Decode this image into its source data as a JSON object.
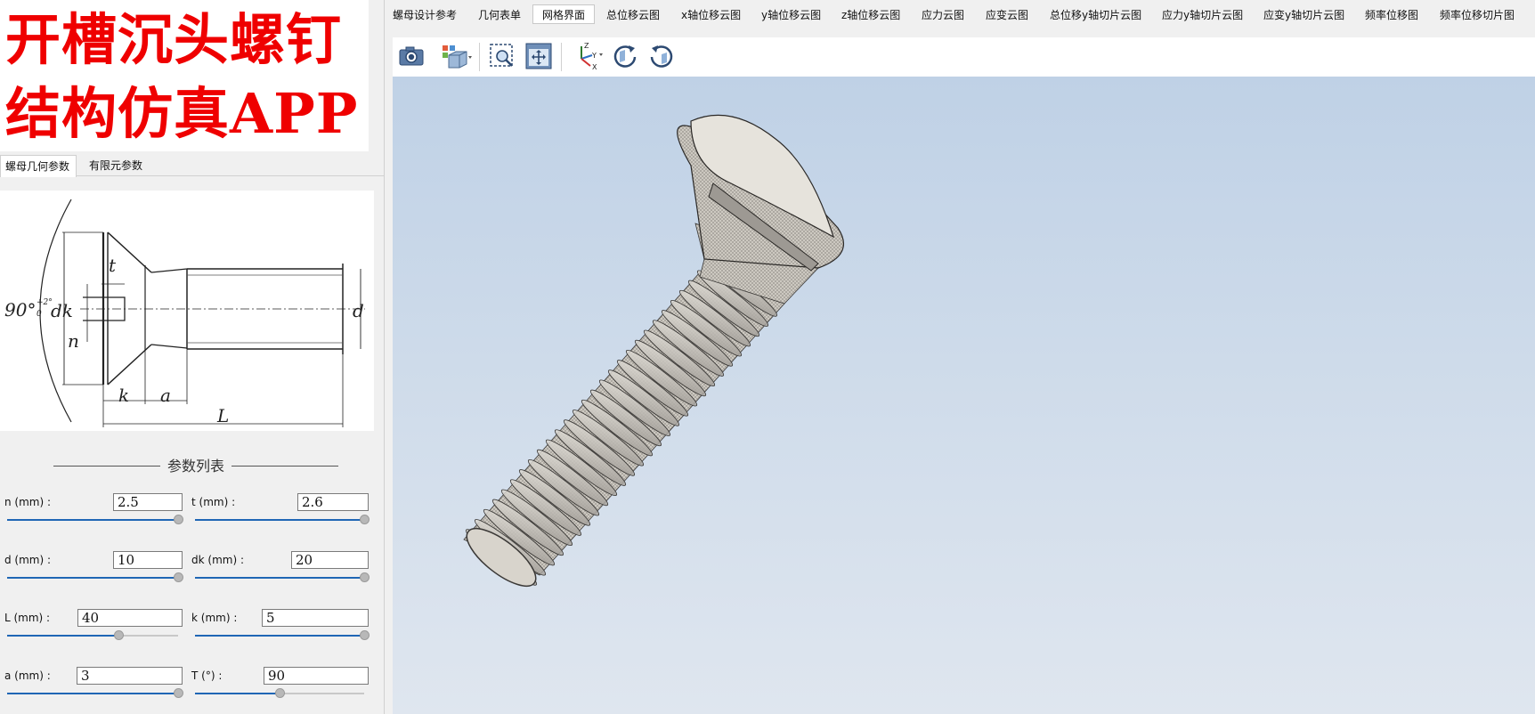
{
  "banner": {
    "line1": "开槽沉头螺钉",
    "line2": "结构仿真APP",
    "color": "#ef0000"
  },
  "left_tabs": [
    {
      "label": "螺母几何参数",
      "active": true
    },
    {
      "label": "有限元参数",
      "active": false
    }
  ],
  "drawing_labels": {
    "angle": "90°",
    "angle_tol_top": "+2°",
    "angle_tol_bottom": "0",
    "dk": "dk",
    "t": "t",
    "n": "n",
    "d": "d",
    "k": "k",
    "a": "a",
    "L": "L"
  },
  "param_section": {
    "title": "参数列表"
  },
  "params": {
    "n": {
      "label": "n (mm) :",
      "value": "2.5",
      "slider_fraction": 1.0
    },
    "t": {
      "label": "t (mm) :",
      "value": "2.6",
      "slider_fraction": 1.0
    },
    "d": {
      "label": "d (mm) :",
      "value": "10",
      "slider_fraction": 1.0
    },
    "dk": {
      "label": "dk (mm) :",
      "value": "20",
      "slider_fraction": 1.0
    },
    "L": {
      "label": "L (mm) :",
      "value": "40",
      "slider_fraction": 0.65
    },
    "k": {
      "label": "k (mm) :",
      "value": "5",
      "slider_fraction": 1.0
    },
    "a": {
      "label": "a (mm) :",
      "value": "3",
      "slider_fraction": 1.0
    },
    "T": {
      "label": "T (°) :",
      "value": "90",
      "slider_fraction": 0.5
    }
  },
  "main_tabs": [
    {
      "label": "螺母设计参考",
      "active": false
    },
    {
      "label": "几何表单",
      "active": false
    },
    {
      "label": "网格界面",
      "active": true
    },
    {
      "label": "总位移云图",
      "active": false
    },
    {
      "label": "x轴位移云图",
      "active": false
    },
    {
      "label": "y轴位移云图",
      "active": false
    },
    {
      "label": "z轴位移云图",
      "active": false
    },
    {
      "label": "应力云图",
      "active": false
    },
    {
      "label": "应变云图",
      "active": false
    },
    {
      "label": "总位移y轴切片云图",
      "active": false
    },
    {
      "label": "应力y轴切片云图",
      "active": false
    },
    {
      "label": "应变y轴切片云图",
      "active": false
    },
    {
      "label": "频率位移图",
      "active": false
    },
    {
      "label": "频率位移切片图",
      "active": false
    }
  ],
  "toolbar": {
    "icons": [
      "camera-icon",
      "view-cube-icon",
      "zoom-box-icon",
      "zoom-extents-icon",
      "axes-orientation-icon",
      "rotate-cw-icon",
      "rotate-ccw-icon"
    ],
    "axis_labels": {
      "z": "Z",
      "y": "Y",
      "x": "X"
    }
  },
  "colors": {
    "accent": "#1f66b5",
    "viewport_top": "#bfd1e6",
    "viewport_bottom": "#dfe6ef",
    "mesh": "#c9c6bf"
  }
}
